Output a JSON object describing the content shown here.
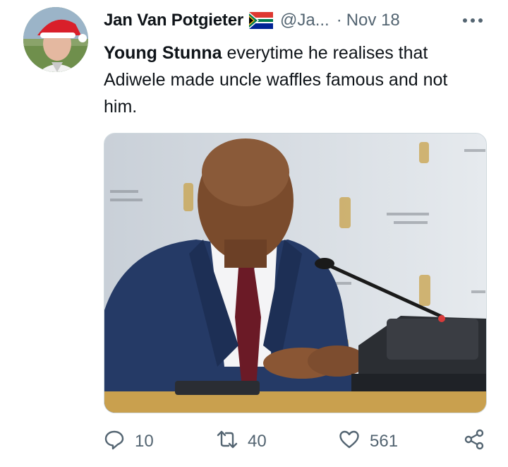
{
  "tweet": {
    "author_name": "Jan Van Potgieter",
    "handle": "@Ja...",
    "separator": "·",
    "date": "Nov 18",
    "text_bold": "Young Stunna",
    "text_rest": " everytime he realises that Adiwele made uncle waffles famous and not him.",
    "more_label": "•••"
  },
  "icons": {
    "flag": "south-africa-flag-icon",
    "reply": "reply-icon",
    "retweet": "retweet-icon",
    "like": "heart-icon",
    "share": "share-icon",
    "more": "more-icon"
  },
  "actions": {
    "replies": "10",
    "retweets": "40",
    "likes": "561"
  },
  "colors": {
    "text": "#0f1419",
    "muted": "#536471",
    "border": "#cfd9de"
  }
}
